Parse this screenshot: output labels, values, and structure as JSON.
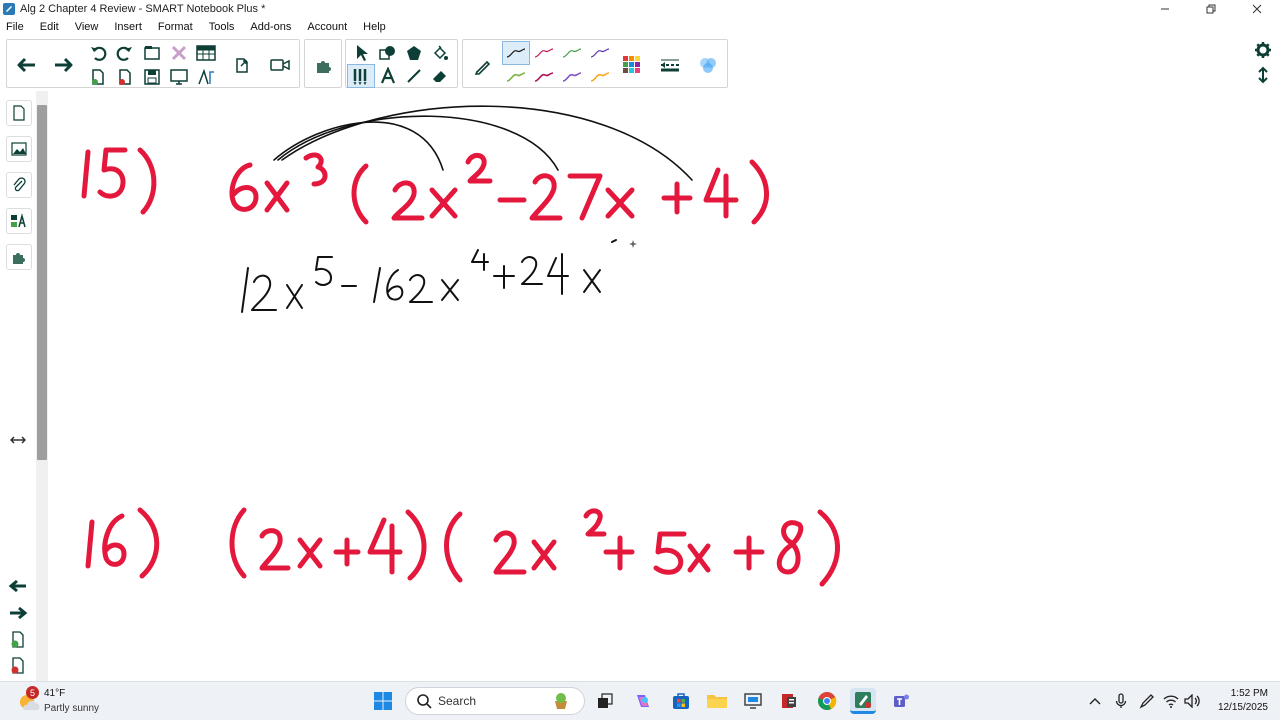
{
  "window": {
    "title": "Alg 2 Chapter 4 Review - SMART Notebook Plus *",
    "controls": [
      "minimize-icon",
      "restore-icon",
      "close-icon"
    ]
  },
  "menu": {
    "items": [
      "File",
      "Edit",
      "View",
      "Insert",
      "Format",
      "Tools",
      "Add-ons",
      "Account",
      "Help"
    ]
  },
  "toolbar": {
    "icons": [
      "back-arrow-icon",
      "forward-arrow-icon",
      "undo-icon",
      "redo-icon",
      "screen-shade-icon",
      "delete-icon",
      "table-icon",
      "new-page-icon",
      "delete-page-icon",
      "save-icon",
      "display-icon",
      "measure-tools-icon",
      "open-window-icon",
      "record-icon",
      "add-ons-icon",
      "select-icon",
      "shapes-icon",
      "polygon-icon",
      "fill-icon",
      "pen-tools-icon",
      "text-icon",
      "line-icon",
      "eraser-icon",
      "pen-icon",
      "colors-icon",
      "line-style-icon",
      "transparency-icon"
    ],
    "pen_colors": [
      "#1a1a1a",
      "#c2185b",
      "#43a047",
      "#5e35b1",
      "#7cb342",
      "#ad1457",
      "#7e57c2",
      "#f9a825"
    ]
  },
  "canvas": {
    "problems": [
      {
        "number": "15)",
        "expression": "6x³(2x² − 27x + 4)",
        "work": "12x⁵ − 162x⁴ + 24x"
      },
      {
        "number": "16)",
        "expression": "(2x+4)(2x² + 5x + 8)"
      }
    ],
    "ink_color": "#e3183c",
    "work_color": "#111111"
  },
  "taskbar": {
    "weather": {
      "temp": "41°F",
      "desc": "Partly sunny",
      "badge": "5"
    },
    "search_label": "Search",
    "clock": {
      "time": "1:52 PM",
      "date": "12/15/2025"
    },
    "apps": [
      "windows-start-icon",
      "search-icon",
      "widgets-icon",
      "task-view-icon",
      "copilot-icon",
      "store-icon",
      "file-explorer-icon",
      "remote-icon",
      "office-icon",
      "chrome-icon",
      "smart-notebook-icon",
      "teams-icon"
    ]
  }
}
